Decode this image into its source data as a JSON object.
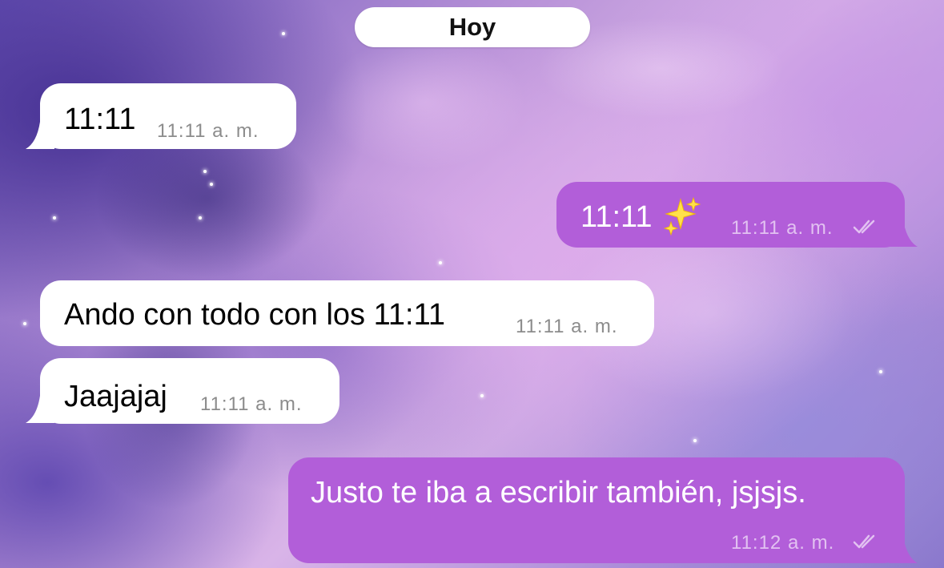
{
  "app": {
    "date_separator": "Hoy"
  },
  "messages": [
    {
      "direction": "incoming",
      "text": "11:11",
      "time": "11:11 a. m."
    },
    {
      "direction": "outgoing",
      "text": "11:11",
      "emoji": "sparkles-emoji",
      "time": "11:11 a. m.",
      "status": "read-double-check"
    },
    {
      "direction": "incoming",
      "text": "Ando con todo con los 11:11",
      "time": "11:11 a. m."
    },
    {
      "direction": "incoming",
      "text": "Jaajajaj",
      "time": "11:11 a. m."
    },
    {
      "direction": "outgoing",
      "text": "Justo te iba a escribir también, jsjsjs.",
      "time": "11:12 a. m.",
      "status": "read-double-check"
    }
  ],
  "colors": {
    "incoming_bubble": "#ffffff",
    "outgoing_bubble": "#b25ed9",
    "date_pill": "#ffffff"
  }
}
